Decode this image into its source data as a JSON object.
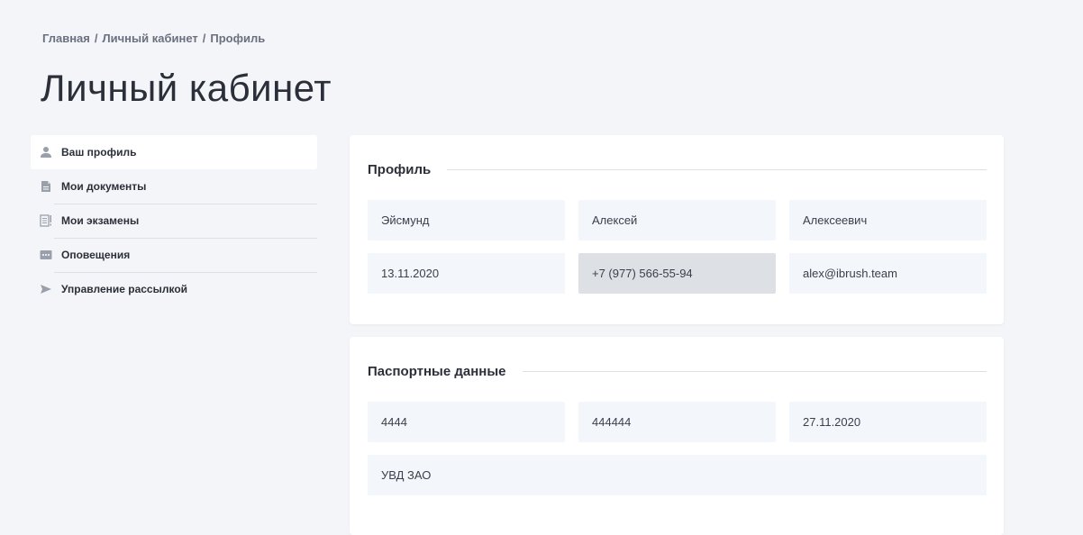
{
  "breadcrumb": {
    "items": [
      "Главная",
      "Личный кабинет",
      "Профиль"
    ],
    "separator": "/"
  },
  "page_title": "Личный кабинет",
  "sidebar": {
    "items": [
      {
        "label": "Ваш профиль",
        "icon": "user-icon",
        "active": true
      },
      {
        "label": "Мои документы",
        "icon": "document-icon",
        "active": false
      },
      {
        "label": "Мои экзамены",
        "icon": "exam-icon",
        "active": false
      },
      {
        "label": "Оповещения",
        "icon": "notification-icon",
        "active": false
      },
      {
        "label": "Управление рассылкой",
        "icon": "send-icon",
        "active": false
      }
    ]
  },
  "profile": {
    "title": "Профиль",
    "last_name": "Эйсмунд",
    "first_name": "Алексей",
    "middle_name": "Алексеевич",
    "birth_date": "13.11.2020",
    "phone": "+7 (977) 566-55-94",
    "email": "alex@ibrush.team"
  },
  "passport": {
    "title": "Паспортные данные",
    "series": "4444",
    "number": "444444",
    "issue_date": "27.11.2020",
    "issued_by": "УВД ЗАО"
  },
  "colors": {
    "background": "#f4f5f8",
    "card": "#ffffff",
    "field": "#f3f6fa",
    "field_disabled": "#dde0e5",
    "icon": "#9aa0ab",
    "text": "#2b2f3a"
  }
}
